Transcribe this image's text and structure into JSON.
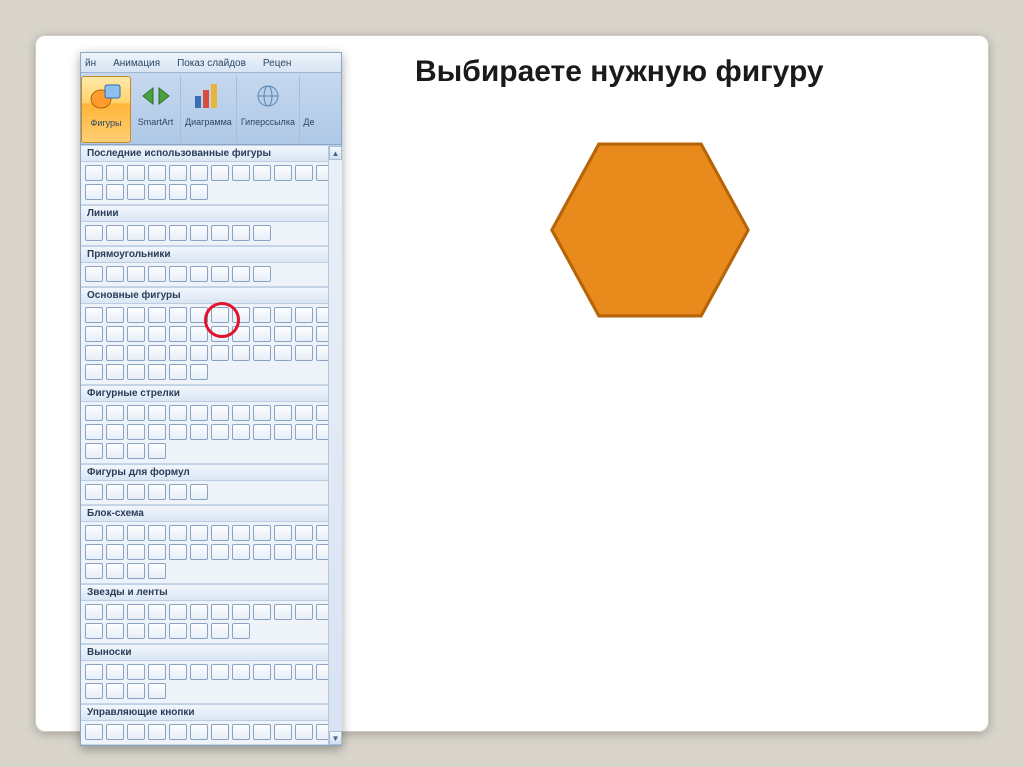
{
  "slide": {
    "title": "Выбираете нужную фигуру",
    "hexagon": {
      "fill": "#e88a1c",
      "stroke": "#b56407"
    }
  },
  "tabs": {
    "cut_left": "йн",
    "items": [
      "Анимация",
      "Показ слайдов",
      "Рецен"
    ]
  },
  "ribbon": {
    "shapes": "Фигуры",
    "smartart": "SmartArt",
    "chart": "Диаграмма",
    "hyperlink": "Гиперссылка",
    "action_cut": "Де"
  },
  "sections": {
    "recent": "Последние использованные фигуры",
    "lines": "Линии",
    "rects": "Прямоугольники",
    "basic": "Основные фигуры",
    "arrows": "Фигурные стрелки",
    "formulas": "Фигуры для формул",
    "flowchart": "Блок-схема",
    "stars": "Звезды и ленты",
    "callouts": "Выноски",
    "actions": "Управляющие кнопки"
  },
  "counts": {
    "recent": 18,
    "lines": 9,
    "rects": 9,
    "basic": 42,
    "arrows": 28,
    "formulas": 6,
    "flowchart": 28,
    "stars": 20,
    "callouts": 16,
    "actions": 12
  }
}
